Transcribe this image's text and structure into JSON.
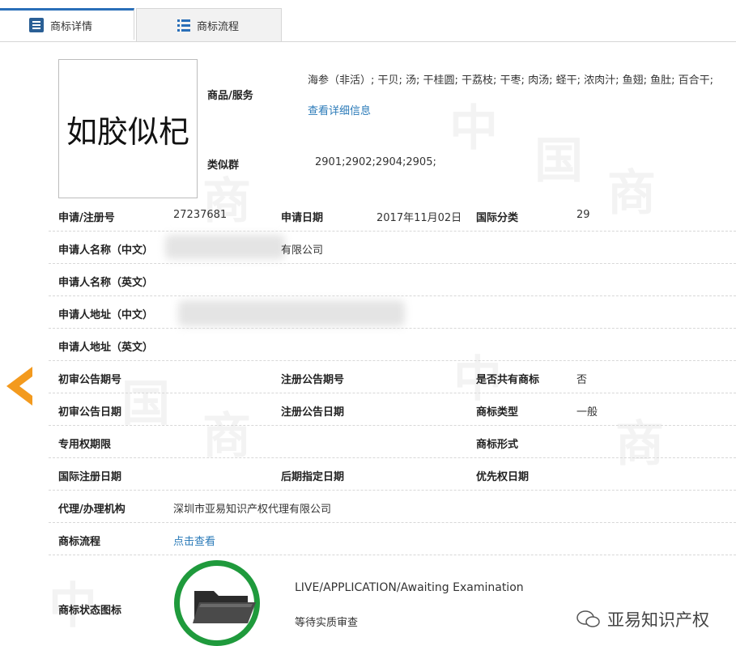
{
  "tabs": [
    {
      "label": "商标详情",
      "icon": "document-icon"
    },
    {
      "label": "商标流程",
      "icon": "list-icon"
    }
  ],
  "mark": {
    "image_text": "如胶似杞",
    "goods_label": "商品/服务",
    "goods_value": "海参（非活）; 干贝; 汤; 干桂圆; 干荔枝; 干枣; 肉汤; 蛏干; 浓肉汁; 鱼翅; 鱼肚; 百合干;",
    "goods_link": "查看详细信息",
    "similar_label": "类似群",
    "similar_value": "2901;2902;2904;2905;"
  },
  "details": {
    "reg_no_label": "申请/注册号",
    "reg_no": "27237681",
    "apply_date_label": "申请日期",
    "apply_date": "2017年11月02日",
    "intl_class_label": "国际分类",
    "intl_class": "29",
    "applicant_cn_label": "申请人名称（中文）",
    "applicant_cn_value": "有限公司",
    "applicant_en_label": "申请人名称（英文）",
    "address_cn_label": "申请人地址（中文）",
    "address_en_label": "申请人地址（英文）",
    "prelim_no_label": "初审公告期号",
    "reg_pub_no_label": "注册公告期号",
    "shared_label": "是否共有商标",
    "shared_value": "否",
    "prelim_date_label": "初审公告日期",
    "reg_pub_date_label": "注册公告日期",
    "type_label": "商标类型",
    "type_value": "一般",
    "exclusive_label": "专用权期限",
    "form_label": "商标形式",
    "intl_reg_date_label": "国际注册日期",
    "later_date_label": "后期指定日期",
    "priority_label": "优先权日期",
    "agent_label": "代理/办理机构",
    "agent_value": "深圳市亚易知识产权代理有限公司",
    "flow_label": "商标流程",
    "flow_link": "点击查看",
    "status_label": "商标状态图标",
    "status_en": "LIVE/APPLICATION/Awaiting Examination",
    "status_cn": "等待实质审查"
  },
  "footer": {
    "brand": "亚易知识产权"
  },
  "colors": {
    "accent": "#2a6fb8",
    "status_green": "#1f9a3c",
    "arrow": "#f39a1e"
  }
}
